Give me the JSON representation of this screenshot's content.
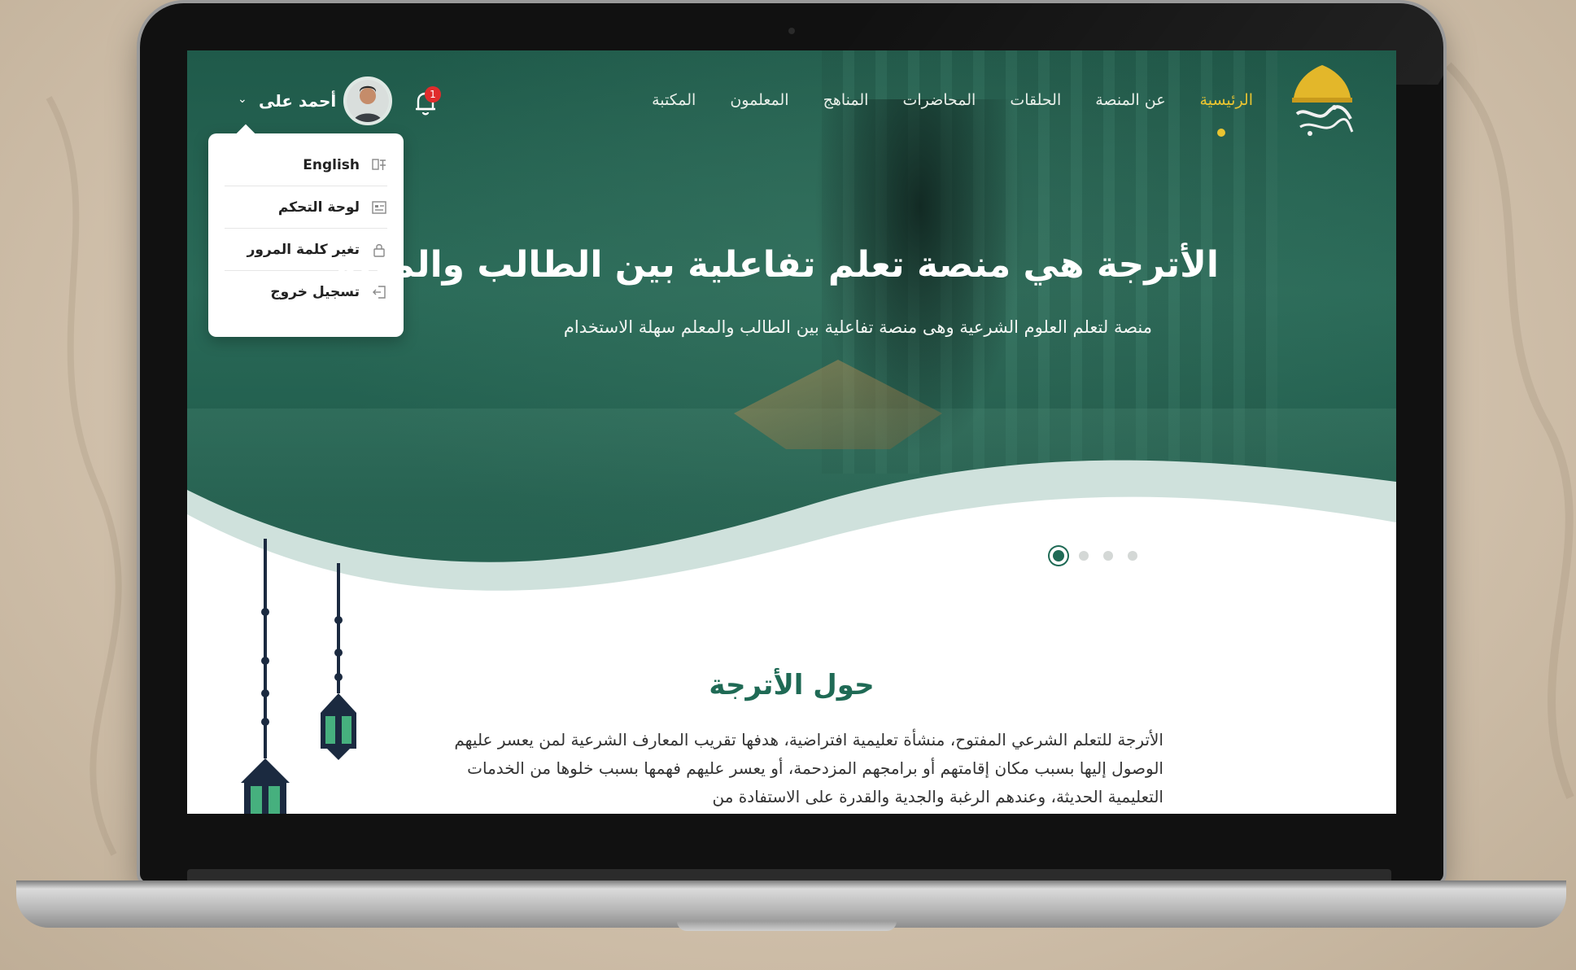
{
  "nav": {
    "items": [
      {
        "label": "الرئيسية",
        "active": true
      },
      {
        "label": "عن المنصة"
      },
      {
        "label": "الحلقات"
      },
      {
        "label": "المحاضرات"
      },
      {
        "label": "المناهج"
      },
      {
        "label": "المعلمون"
      },
      {
        "label": "المكتبة"
      }
    ],
    "notifications_count": "1",
    "user_name": "أحمد على",
    "user_caret": "⌄"
  },
  "user_menu": {
    "items": [
      {
        "label": "English",
        "icon": "translate-icon"
      },
      {
        "label": "لوحة التحكم",
        "icon": "dashboard-icon"
      },
      {
        "label": "تغير كلمة المرور",
        "icon": "lock-icon"
      },
      {
        "label": "تسجيل خروج",
        "icon": "logout-icon"
      }
    ]
  },
  "hero": {
    "title": "الأترجة هي منصة تعلم تفاعلية بين الطالب والمعلم",
    "subtitle": "منصة لتعلم العلوم الشرعية وهى منصة تفاعلية بين الطالب والمعلم سهلة الاستخدام",
    "slides_count": 4,
    "active_slide": 1
  },
  "about": {
    "title": "حول الأترجة",
    "text": "الأترجة للتعلم الشرعي المفتوح، منشأة تعليمية افتراضية، هدفها تقريب المعارف الشرعية لمن يعسر عليهم الوصول إليها بسبب مكان إقامتهم أو برامجهم المزدحمة، أو يعسر عليهم فهمها بسبب خلوها من الخدمات التعليمية الحديثة، وعندهم الرغبة والجدية والقدرة على الاستفادة من"
  },
  "colors": {
    "brand_green": "#1f6a55",
    "accent_gold": "#e9c431",
    "badge_red": "#e02c2c"
  }
}
